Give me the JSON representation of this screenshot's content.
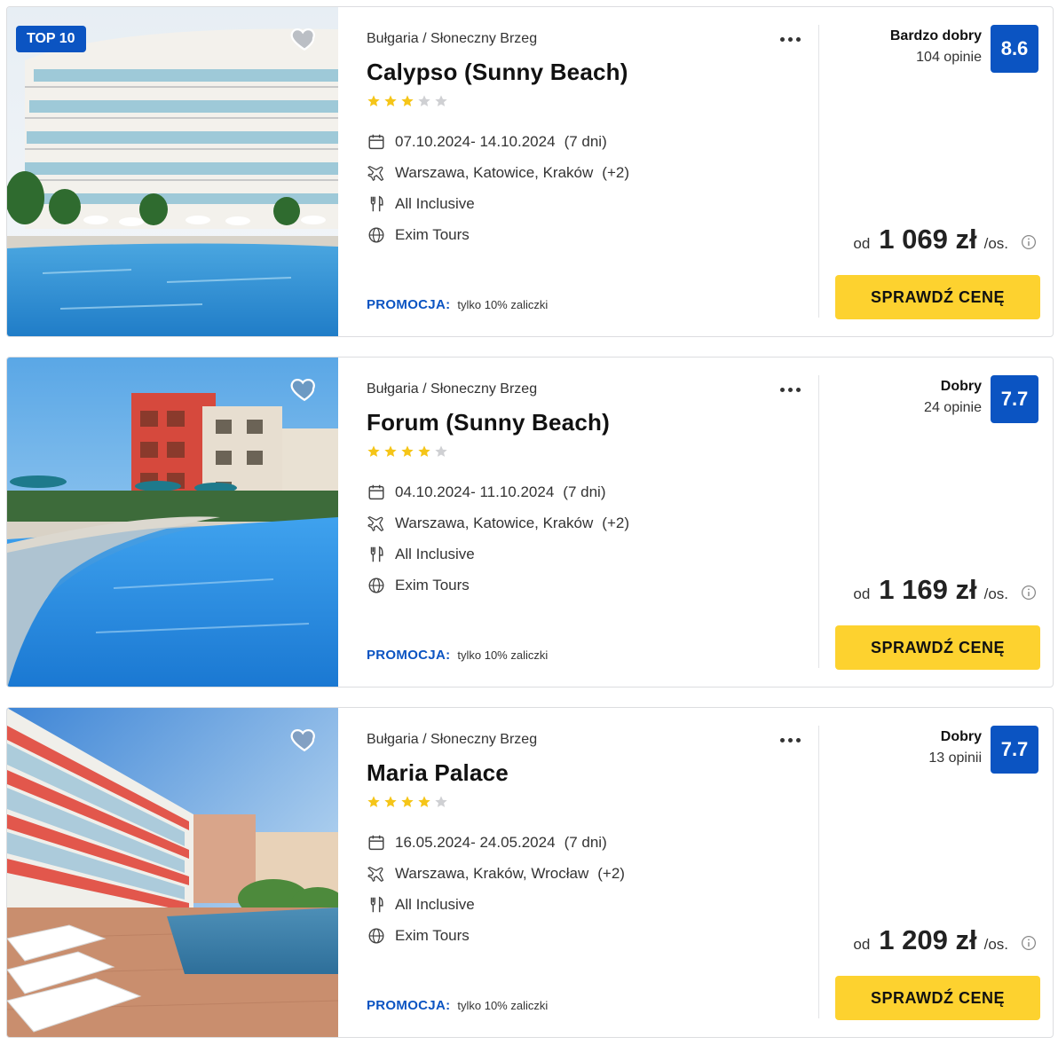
{
  "colors": {
    "accent": "#0b54c2",
    "cta": "#fdd22f",
    "star": "#f5c518",
    "star_empty": "#cfd0d3"
  },
  "offers": [
    {
      "badge": "TOP 10",
      "location": "Bułgaria / Słoneczny Brzeg",
      "name": "Calypso (Sunny Beach)",
      "stars": 3,
      "dates": "07.10.2024- 14.10.2024",
      "duration": "(7 dni)",
      "departures": "Warszawa, Katowice, Kraków",
      "departures_more": "(+2)",
      "board": "All Inclusive",
      "operator": "Exim Tours",
      "promo_label": "PROMOCJA:",
      "promo_text": "tylko 10% zaliczki",
      "rating_label": "Bardzo dobry",
      "reviews": "104 opinie",
      "score": "8.6",
      "price_prefix": "od",
      "price": "1 069 zł",
      "price_suffix": "/os.",
      "cta": "SPRAWDŹ CENĘ"
    },
    {
      "badge": "",
      "location": "Bułgaria / Słoneczny Brzeg",
      "name": "Forum (Sunny Beach)",
      "stars": 4,
      "dates": "04.10.2024- 11.10.2024",
      "duration": "(7 dni)",
      "departures": "Warszawa, Katowice, Kraków",
      "departures_more": "(+2)",
      "board": "All Inclusive",
      "operator": "Exim Tours",
      "promo_label": "PROMOCJA:",
      "promo_text": "tylko 10% zaliczki",
      "rating_label": "Dobry",
      "reviews": "24 opinie",
      "score": "7.7",
      "price_prefix": "od",
      "price": "1 169 zł",
      "price_suffix": "/os.",
      "cta": "SPRAWDŹ CENĘ"
    },
    {
      "badge": "",
      "location": "Bułgaria / Słoneczny Brzeg",
      "name": "Maria Palace",
      "stars": 4,
      "dates": "16.05.2024- 24.05.2024",
      "duration": "(7 dni)",
      "departures": "Warszawa, Kraków, Wrocław",
      "departures_more": "(+2)",
      "board": "All Inclusive",
      "operator": "Exim Tours",
      "promo_label": "PROMOCJA:",
      "promo_text": "tylko 10% zaliczki",
      "rating_label": "Dobry",
      "reviews": "13 opinii",
      "score": "7.7",
      "price_prefix": "od",
      "price": "1 209 zł",
      "price_suffix": "/os.",
      "cta": "SPRAWDŹ CENĘ"
    }
  ]
}
